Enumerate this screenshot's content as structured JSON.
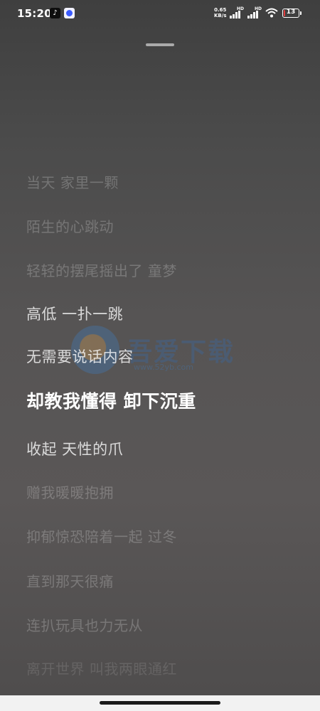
{
  "status_bar": {
    "time": "15:20",
    "network_speed_value": "0.65",
    "network_speed_unit": "KB/s",
    "signal_1_label": "HD",
    "signal_2_label": "HD",
    "battery_level": "13",
    "app_icons": [
      "tiktok-icon",
      "app-icon"
    ]
  },
  "lyrics": {
    "lines": [
      "当天 家里一颗",
      "陌生的心跳动",
      "轻轻的摆尾摇出了 童梦",
      "高低 一扑一跳",
      "无需要说话内容",
      "却教我懂得 卸下沉重",
      "收起 天性的爪",
      "赠我暖暖抱拥",
      "抑郁惊恐陪着一起 过冬",
      "直到那天很痛",
      "连扒玩具也力无从",
      "离开世界 叫我两眼通红"
    ],
    "active_index": 5
  },
  "watermark": {
    "brand": "吾爱下载",
    "url": "www.52yb.com"
  },
  "colors": {
    "accent_active": "#ffffff",
    "battery_low": "#e23b3b"
  }
}
